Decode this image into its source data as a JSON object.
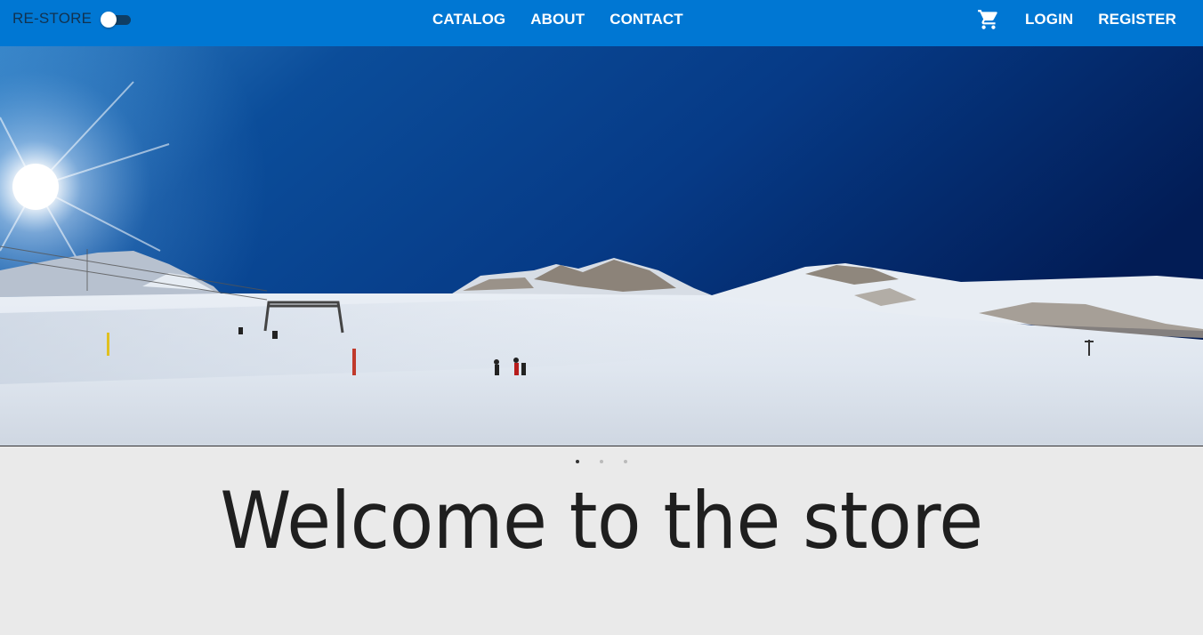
{
  "header": {
    "brand": "RE-STORE",
    "theme_toggle": {
      "icon": "toggle-switch-icon",
      "checked": false
    },
    "nav_center": [
      "CATALOG",
      "ABOUT",
      "CONTACT"
    ],
    "nav_right": {
      "cart_icon": "shopping-cart-icon",
      "login": "LOGIN",
      "register": "REGISTER"
    },
    "color": "#0077d3"
  },
  "hero": {
    "image": "ski-slope-panorama",
    "slides": 3,
    "active_slide": 1
  },
  "main": {
    "heading": "Welcome to the store"
  }
}
